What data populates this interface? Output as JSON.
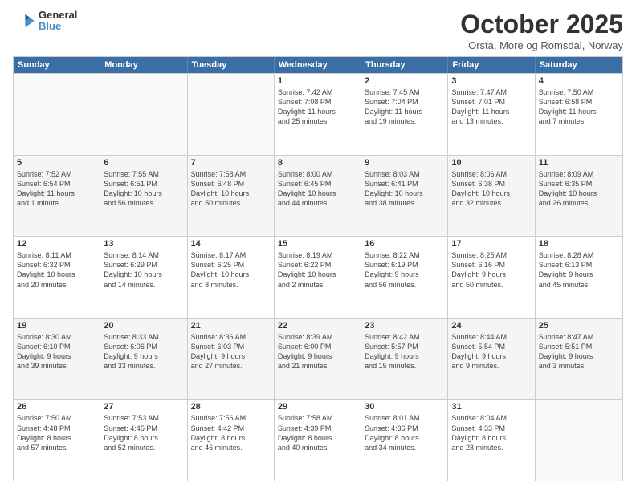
{
  "logo": {
    "line1": "General",
    "line2": "Blue"
  },
  "title": "October 2025",
  "location": "Orsta, More og Romsdal, Norway",
  "header_days": [
    "Sunday",
    "Monday",
    "Tuesday",
    "Wednesday",
    "Thursday",
    "Friday",
    "Saturday"
  ],
  "weeks": [
    [
      {
        "day": "",
        "text": ""
      },
      {
        "day": "",
        "text": ""
      },
      {
        "day": "",
        "text": ""
      },
      {
        "day": "1",
        "text": "Sunrise: 7:42 AM\nSunset: 7:08 PM\nDaylight: 11 hours\nand 25 minutes."
      },
      {
        "day": "2",
        "text": "Sunrise: 7:45 AM\nSunset: 7:04 PM\nDaylight: 11 hours\nand 19 minutes."
      },
      {
        "day": "3",
        "text": "Sunrise: 7:47 AM\nSunset: 7:01 PM\nDaylight: 11 hours\nand 13 minutes."
      },
      {
        "day": "4",
        "text": "Sunrise: 7:50 AM\nSunset: 6:58 PM\nDaylight: 11 hours\nand 7 minutes."
      }
    ],
    [
      {
        "day": "5",
        "text": "Sunrise: 7:52 AM\nSunset: 6:54 PM\nDaylight: 11 hours\nand 1 minute."
      },
      {
        "day": "6",
        "text": "Sunrise: 7:55 AM\nSunset: 6:51 PM\nDaylight: 10 hours\nand 56 minutes."
      },
      {
        "day": "7",
        "text": "Sunrise: 7:58 AM\nSunset: 6:48 PM\nDaylight: 10 hours\nand 50 minutes."
      },
      {
        "day": "8",
        "text": "Sunrise: 8:00 AM\nSunset: 6:45 PM\nDaylight: 10 hours\nand 44 minutes."
      },
      {
        "day": "9",
        "text": "Sunrise: 8:03 AM\nSunset: 6:41 PM\nDaylight: 10 hours\nand 38 minutes."
      },
      {
        "day": "10",
        "text": "Sunrise: 8:06 AM\nSunset: 6:38 PM\nDaylight: 10 hours\nand 32 minutes."
      },
      {
        "day": "11",
        "text": "Sunrise: 8:09 AM\nSunset: 6:35 PM\nDaylight: 10 hours\nand 26 minutes."
      }
    ],
    [
      {
        "day": "12",
        "text": "Sunrise: 8:11 AM\nSunset: 6:32 PM\nDaylight: 10 hours\nand 20 minutes."
      },
      {
        "day": "13",
        "text": "Sunrise: 8:14 AM\nSunset: 6:29 PM\nDaylight: 10 hours\nand 14 minutes."
      },
      {
        "day": "14",
        "text": "Sunrise: 8:17 AM\nSunset: 6:25 PM\nDaylight: 10 hours\nand 8 minutes."
      },
      {
        "day": "15",
        "text": "Sunrise: 8:19 AM\nSunset: 6:22 PM\nDaylight: 10 hours\nand 2 minutes."
      },
      {
        "day": "16",
        "text": "Sunrise: 8:22 AM\nSunset: 6:19 PM\nDaylight: 9 hours\nand 56 minutes."
      },
      {
        "day": "17",
        "text": "Sunrise: 8:25 AM\nSunset: 6:16 PM\nDaylight: 9 hours\nand 50 minutes."
      },
      {
        "day": "18",
        "text": "Sunrise: 8:28 AM\nSunset: 6:13 PM\nDaylight: 9 hours\nand 45 minutes."
      }
    ],
    [
      {
        "day": "19",
        "text": "Sunrise: 8:30 AM\nSunset: 6:10 PM\nDaylight: 9 hours\nand 39 minutes."
      },
      {
        "day": "20",
        "text": "Sunrise: 8:33 AM\nSunset: 6:06 PM\nDaylight: 9 hours\nand 33 minutes."
      },
      {
        "day": "21",
        "text": "Sunrise: 8:36 AM\nSunset: 6:03 PM\nDaylight: 9 hours\nand 27 minutes."
      },
      {
        "day": "22",
        "text": "Sunrise: 8:39 AM\nSunset: 6:00 PM\nDaylight: 9 hours\nand 21 minutes."
      },
      {
        "day": "23",
        "text": "Sunrise: 8:42 AM\nSunset: 5:57 PM\nDaylight: 9 hours\nand 15 minutes."
      },
      {
        "day": "24",
        "text": "Sunrise: 8:44 AM\nSunset: 5:54 PM\nDaylight: 9 hours\nand 9 minutes."
      },
      {
        "day": "25",
        "text": "Sunrise: 8:47 AM\nSunset: 5:51 PM\nDaylight: 9 hours\nand 3 minutes."
      }
    ],
    [
      {
        "day": "26",
        "text": "Sunrise: 7:50 AM\nSunset: 4:48 PM\nDaylight: 8 hours\nand 57 minutes."
      },
      {
        "day": "27",
        "text": "Sunrise: 7:53 AM\nSunset: 4:45 PM\nDaylight: 8 hours\nand 52 minutes."
      },
      {
        "day": "28",
        "text": "Sunrise: 7:56 AM\nSunset: 4:42 PM\nDaylight: 8 hours\nand 46 minutes."
      },
      {
        "day": "29",
        "text": "Sunrise: 7:58 AM\nSunset: 4:39 PM\nDaylight: 8 hours\nand 40 minutes."
      },
      {
        "day": "30",
        "text": "Sunrise: 8:01 AM\nSunset: 4:36 PM\nDaylight: 8 hours\nand 34 minutes."
      },
      {
        "day": "31",
        "text": "Sunrise: 8:04 AM\nSunset: 4:33 PM\nDaylight: 8 hours\nand 28 minutes."
      },
      {
        "day": "",
        "text": ""
      }
    ]
  ]
}
